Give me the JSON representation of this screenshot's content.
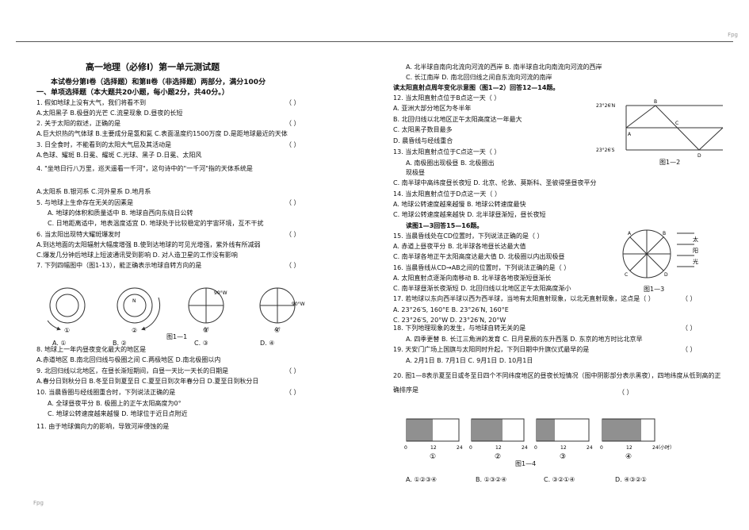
{
  "page_marker": "Fpg",
  "title": "高一地理（必修Ⅰ）第一单元测试题",
  "intro": "本试卷分第Ⅰ卷（选择题）和第Ⅱ卷（非选择题）两部分，满分100分",
  "section1": "一、单项选择题（本大题共20小题，每小题2分，共40分。）",
  "left_lines": [
    "1. 假如地球上没有大气，我们将看不到",
    "A.太阳黑子    B.极昼的光芒    C.流星现象    D.昼夜的长短",
    "2. 关于太阳的叙述，正确的是",
    "A.巨大炽热的气体球    B.主要成分是氢和氦    C.表面温度约1500万度    D.是距地球最近的天体",
    "3. 日全食时，不能看到的太阳大气层及其活动是",
    "A.色球、耀斑    B.日冕、耀斑    C.光球、黑子    D.日冕、太阳风",
    "4. \"坐地日行八万里，巡天遥看一千河\"，这句诗中的\"一千河\"指的天体系统是",
    "A.太阳系    B.银河系    C.河外星系    D.地月系",
    "5. 与地球上生命存在无关的因素是",
    "A. 地球的体积和质量适中    B. 地球自西向东绕日公转",
    "C. 日地距离适中，地表温度适宜    D. 地球处于比较稳定的宇宙环境，互不干扰",
    "6. 当太阳出现特大耀斑爆发时",
    "A.到达地面的太阳辐射大幅度增强    B.使到达地球的可见光增强，紫外线有所减弱",
    "C.爆发几分钟后地球上短波通讯受到影响    D. 对人造卫星的工作没有影响",
    "7. 下列四幅图中（图1-13），能正确表示地球自转方向的是",
    "8. 地球上一年内昼夜变化最大的地区是",
    "A.赤道地区    B.南北回归线与极圈之间    C.两极地区    D.南北极圈以内",
    "9. 北回归线以北地区，在昼长渐短期间，白昼一天比一天长的日期是",
    "A.春分日到秋分日    B.冬至日到夏至日    C.夏至日到次年春分日    D.夏至日到秋分日",
    "10. 当晨昏圈与经线圈重合时，下列说法正确的是",
    "A. 全球昼夜平分    B. 极圈上的正午太阳高度为0°",
    "C. 地球公转速度越来越慢    D. 地球位于近日点附近",
    "11. 由于地球偏向力的影响，导致河岸侵蚀的是"
  ],
  "brackets": "（     ）",
  "fig13_label": "图1—1",
  "fig13_options": [
    "A. ①",
    "B. ②",
    "C. ③",
    "D. ④"
  ],
  "fig13_nums": [
    "①",
    "②",
    "③",
    "④"
  ],
  "fig13_text": [
    "N",
    "90°W",
    "0°",
    "0°",
    "90°W"
  ],
  "right_lines": [
    "A. 北半球自南向北流向河流的西岸    B. 南半球自北向南流向河流的西岸",
    "C. 长江南岸    D. 南北回归线之间自东流向河流的南岸",
    "读太阳直射点周年变化示意图（图1—2）回答12—14题。",
    "12. 当太阳直射点位于B点这一天（    ）",
    "A. 亚洲大部分地区为冬半年",
    "B. 北回归线以北地区正午太阳高度达一年最大",
    "C. 太阳黑子数目最多",
    "D. 晨昏线与经线重合",
    "13. 当太阳直射点位于C点这一天（    ）",
    "A. 南极圈出现极昼    B. 北极圈出",
    "现极昼",
    "C. 南半球中高纬度昼长夜短    D. 北京、伦敦、莫斯科、圣彼得堡昼夜平分",
    "14. 当太阳直射点位于D点这一天（    ）",
    "A. 地球公转速度越来越慢    B. 地球公转速度最快",
    "C. 地球公转速度越来越快    D. 北半球昼渐短，昼长夜短",
    "读图1—3回答15—16题。",
    "15. 当晨昏线处在CD位置时，下列说法正确的是（    ）",
    "A. 赤道上昼夜平分    B. 北半球各地昼长达最大值",
    "C. 南半球各地正午太阳高度达最大值    D. 北极圈以内出现极昼",
    "16. 当晨昏线从CD→AB之间的位置时，下列说法正确的是（    ）",
    "A. 太阳直射点逐渐向南移动    B. 北半球各地夜渐短昼渐长",
    "C. 南半球昼渐长夜渐短    D. 北回归线以北地区正午太阳高度渐小",
    "17. 若地球以东向西半球以西为西半球，当地有太阳直射现象，以北无直射现象，这点是（    ）",
    "A. 23°26′S, 160°E    B. 23°26′N, 160°E",
    "C. 23°26′S, 20°W    D. 23°26′N, 20°W",
    "18. 下列地理现象的发生，与地球自转无关的是",
    "A. 四季更替    B. 长江三角洲的发育    C. 日月星辰的东升西落    D. 东京的地方时比北京早",
    "19. 天安门广场上国旗与太阳同时升起，下列日期中升旗仪式最早的是",
    "A. 2月1日    B. 7月1日    C. 9月1日    D. 10月1日",
    "20. 图1—8表示夏至日或冬至日四个不同纬度地区的昼夜长短情况（图中阴影部分表示黑夜），四地纬度从低到高的正确排序是"
  ],
  "fig2": {
    "label": "图1—2",
    "lat_n": "23°26′N",
    "lat_s": "23°26′S",
    "points": [
      "A",
      "B",
      "C",
      "D"
    ]
  },
  "fig3": {
    "label": "图1—3",
    "side_text": [
      "太",
      "阳",
      "光"
    ],
    "points": [
      "A",
      "B",
      "C",
      "D"
    ]
  },
  "fig4": {
    "label": "图1—4",
    "nums": [
      "①",
      "②",
      "③",
      "④"
    ],
    "ticks": [
      "0",
      "12",
      "24"
    ],
    "unit": "（小时）",
    "night_fraction": [
      0.5,
      0.6,
      0.35,
      0.75
    ]
  },
  "q20_options": [
    "A. ①②③④",
    "B. ①③②④",
    "C. ③②①④",
    "D. ④③②①"
  ]
}
